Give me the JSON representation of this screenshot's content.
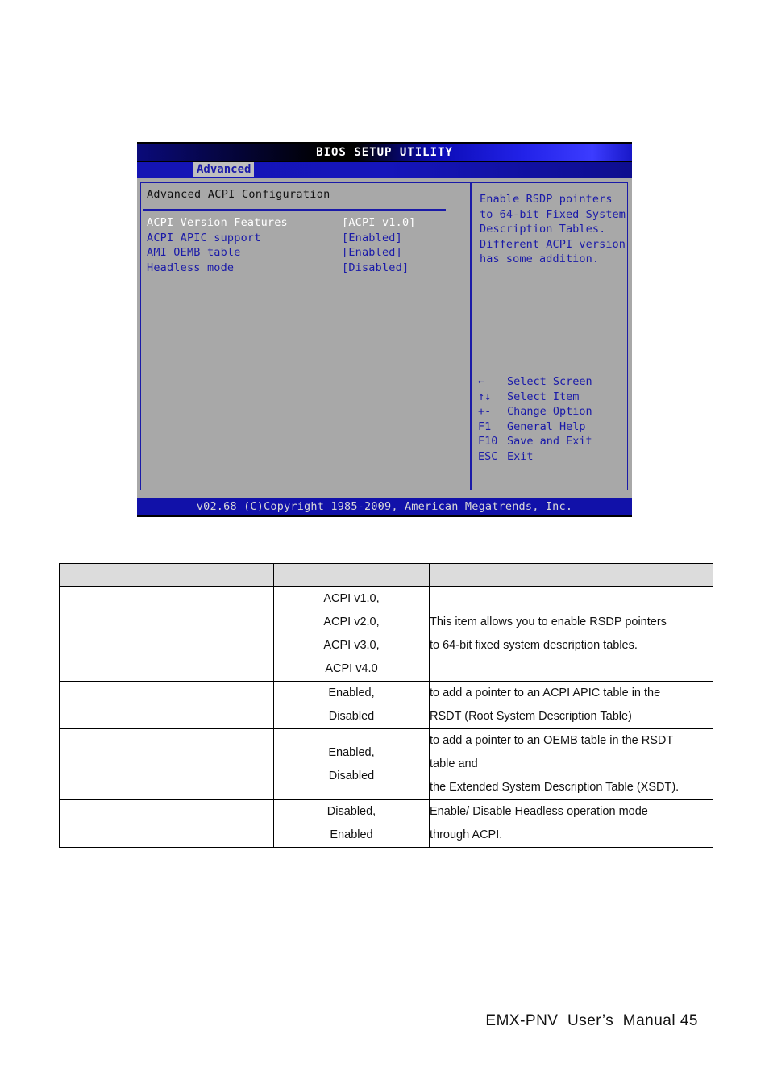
{
  "bios": {
    "title": "BIOS SETUP UTILITY",
    "active_tab": "Advanced",
    "section_title": "Advanced ACPI Configuration",
    "options": [
      {
        "label": "ACPI Version Features",
        "value": "[ACPI v1.0]",
        "selected": true
      },
      {
        "label": "ACPI APIC support",
        "value": "[Enabled]",
        "selected": false
      },
      {
        "label": "AMI OEMB table",
        "value": "[Enabled]",
        "selected": false
      },
      {
        "label": "Headless mode",
        "value": "[Disabled]",
        "selected": false
      }
    ],
    "help_text": "Enable RSDP pointers\nto 64-bit Fixed System\nDescription Tables.\nDifferent ACPI version\nhas some addition.",
    "keys": [
      {
        "glyph": "←",
        "desc": "Select Screen",
        "name": "key-select-screen"
      },
      {
        "glyph": "↑↓",
        "desc": "Select Item",
        "name": "key-select-item"
      },
      {
        "glyph": "+-",
        "desc": "Change Option",
        "name": "key-change-option"
      },
      {
        "glyph": "F1",
        "desc": "General Help",
        "name": "key-general-help"
      },
      {
        "glyph": "F10",
        "desc": "Save and Exit",
        "name": "key-save-and-exit"
      },
      {
        "glyph": "ESC",
        "desc": "Exit",
        "name": "key-exit"
      }
    ],
    "footer": "v02.68 (C)Copyright 1985-2009, American Megatrends, Inc.",
    "colors": {
      "panel_bg": "#a8a8a8",
      "text_blue": "#1a1aa8",
      "text_selected": "#ffffff",
      "footer_bar": "#1111a9",
      "tab_bg": "#bfbfbf"
    }
  },
  "table": {
    "headers": [
      "",
      "",
      ""
    ],
    "rows": [
      {
        "feature": "",
        "options": "ACPI v1.0,\nACPI v2.0,\nACPI v3.0,\nACPI v4.0",
        "description": "This item allows you to enable RSDP pointers\nto 64-bit fixed system description tables."
      },
      {
        "feature": "",
        "options": "Enabled,\nDisabled",
        "description": "to add a pointer to an ACPI APIC table in the\nRSDT (Root System Description Table)"
      },
      {
        "feature": "",
        "options": "Enabled,\nDisabled",
        "description": "to add a pointer to an OEMB table in the RSDT\ntable and\nthe Extended System Description Table (XSDT)."
      },
      {
        "feature": "",
        "options": "Disabled,\nEnabled",
        "description": "Enable/ Disable Headless operation mode\nthrough ACPI."
      }
    ]
  },
  "page": {
    "footer": "EMX-PNV  User’s  Manual 45"
  }
}
